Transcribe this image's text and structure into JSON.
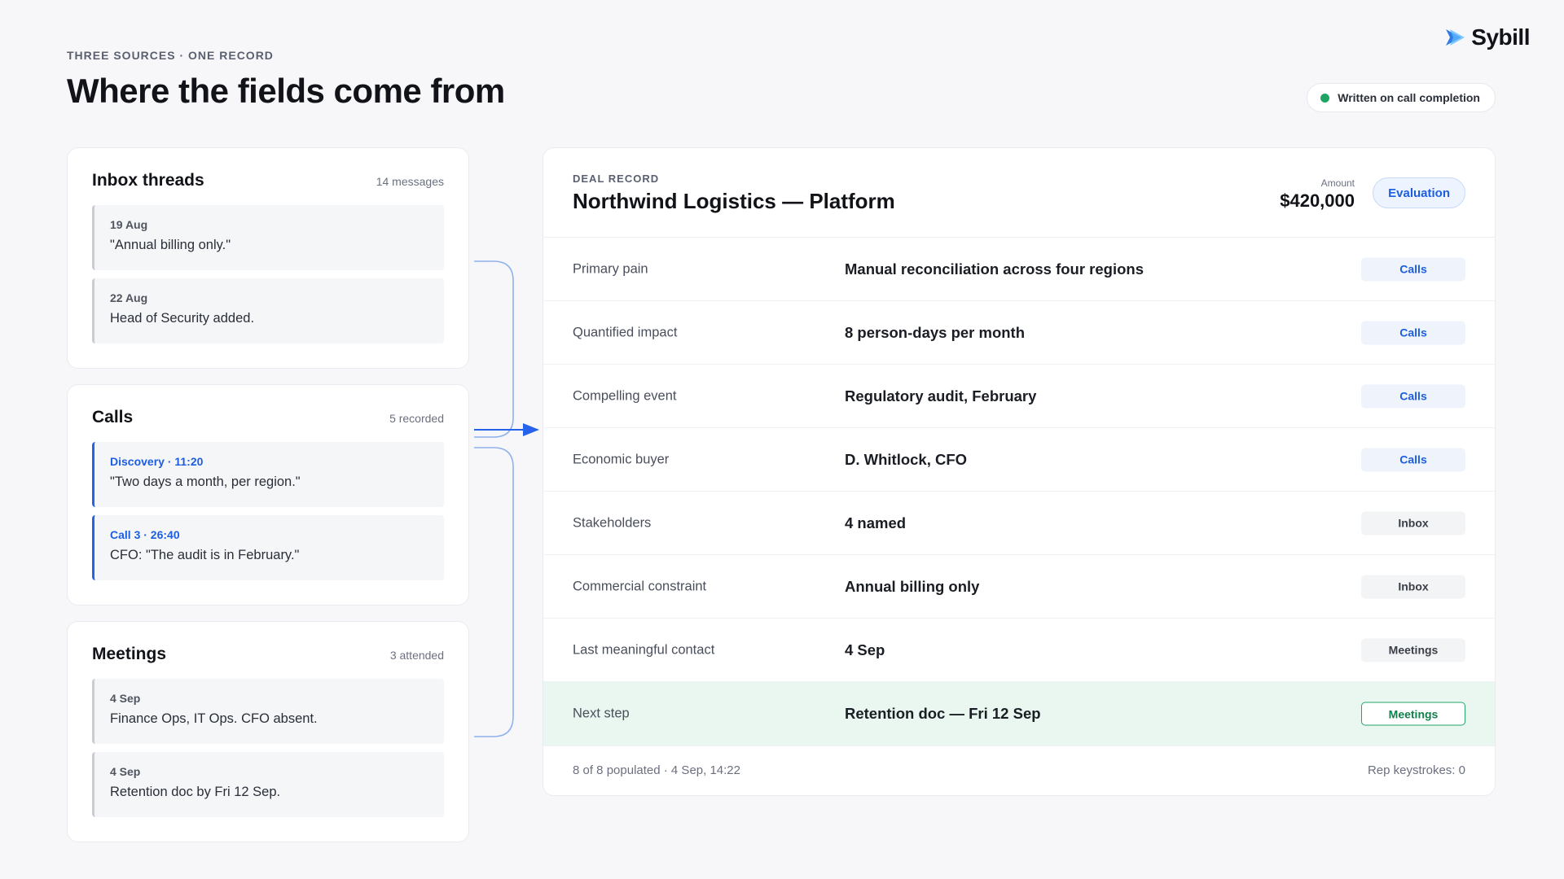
{
  "header": {
    "eyebrow": "THREE SOURCES · ONE RECORD",
    "title": "Where the fields come from",
    "brand": "Sybill",
    "status": "Written on call completion",
    "status_color": "#1fa463"
  },
  "sources": {
    "inbox": {
      "title": "Inbox threads",
      "count": "14 messages",
      "items": [
        {
          "meta": "19 Aug",
          "text": "\"Annual billing only.\""
        },
        {
          "meta": "22 Aug",
          "text": "Head of Security added."
        }
      ]
    },
    "calls": {
      "title": "Calls",
      "count": "5 recorded",
      "items": [
        {
          "meta": "Discovery · 11:20",
          "text": "\"Two days a month, per region.\""
        },
        {
          "meta": "Call 3 · 26:40",
          "text": "CFO: \"The audit is in February.\""
        }
      ]
    },
    "meetings": {
      "title": "Meetings",
      "count": "3 attended",
      "items": [
        {
          "meta": "4 Sep",
          "text": "Finance Ops, IT Ops. CFO absent."
        },
        {
          "meta": "4 Sep",
          "text": "Retention doc by Fri 12 Sep."
        }
      ]
    }
  },
  "deal": {
    "eyebrow": "DEAL RECORD",
    "title": "Northwind Logistics — Platform",
    "amount_label": "Amount",
    "amount": "$420,000",
    "stage": "Evaluation",
    "fields": [
      {
        "label": "Primary pain",
        "value": "Manual reconciliation across four regions",
        "source": "Calls"
      },
      {
        "label": "Quantified impact",
        "value": "8 person-days per month",
        "source": "Calls"
      },
      {
        "label": "Compelling event",
        "value": "Regulatory audit, February",
        "source": "Calls"
      },
      {
        "label": "Economic buyer",
        "value": "D. Whitlock, CFO",
        "source": "Calls"
      },
      {
        "label": "Stakeholders",
        "value": "4 named",
        "source": "Inbox"
      },
      {
        "label": "Commercial constraint",
        "value": "Annual billing only",
        "source": "Inbox"
      },
      {
        "label": "Last meaningful contact",
        "value": "4 Sep",
        "source": "Meetings"
      },
      {
        "label": "Next step",
        "value": "Retention doc — Fri 12 Sep",
        "source": "Meetings"
      }
    ],
    "footer_left": "8 of 8 populated · 4 Sep, 14:22",
    "footer_right": "Rep keystrokes: 0"
  },
  "colors": {
    "accent": "#2563eb",
    "calls_tag": "#1d5ee0",
    "highlight_bg": "#e9f7f0",
    "highlight_border": "#22a566"
  }
}
